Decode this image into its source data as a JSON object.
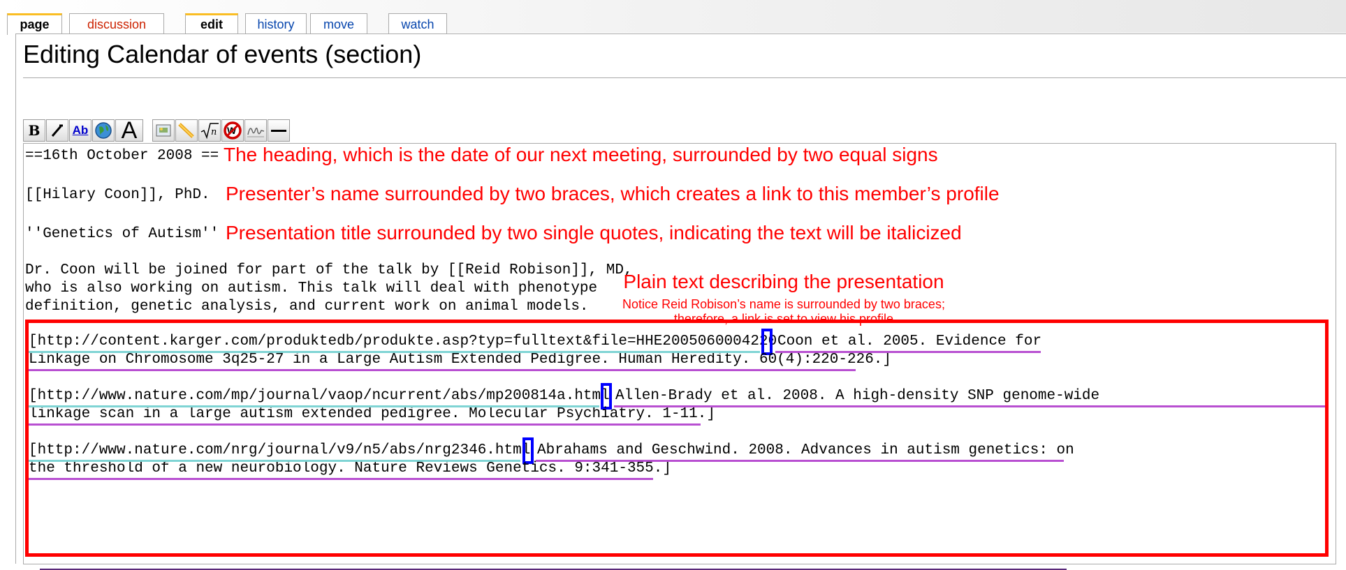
{
  "tabs": [
    {
      "label": "page"
    },
    {
      "label": "discussion"
    },
    {
      "label": "edit"
    },
    {
      "label": "history"
    },
    {
      "label": "move"
    },
    {
      "label": "watch"
    }
  ],
  "page_title": "Editing Calendar of events (section)",
  "toolbar": {
    "bold_label": "B",
    "italic_label": "I",
    "link_label": "Ab",
    "headline_label": "A"
  },
  "editor": {
    "line_heading": "==16th October 2008 ==",
    "line_presenter": "[[Hilary Coon]], PhD.",
    "line_title": "''Genetics of Autism''",
    "desc_1": "Dr. Coon will be joined for part of the talk by [[Reid Robison]], MD,",
    "desc_2": "who is also working on autism. This talk will deal with phenotype",
    "desc_3": "definition, genetic analysis, and current work on animal models.",
    "ref1_url": "[http://content.karger.com/produktedb/produkte.asp?typ=fulltext&file=HHE2005060004220",
    "ref1_text_a": "Coon et al. 2005. Evidence for",
    "ref1_text_b": "Linkage on Chromosome 3q25-27 in a Large Autism Extended Pedigree. Human Heredity. 60(4):220-226.]",
    "ref2_url": "[http://www.nature.com/mp/journal/vaop/ncurrent/abs/mp200814a.html",
    "ref2_text_a": "Allen-Brady et al. 2008. A high-density SNP genome-wide",
    "ref2_text_b": "linkage scan in a large autism extended pedigree. Molecular Psychiatry. 1-11.]",
    "ref3_url": "[http://www.nature.com/nrg/journal/v9/n5/abs/nrg2346.html",
    "ref3_text_a": "Abrahams and Geschwind. 2008. Advances in autism genetics: on",
    "ref3_text_b": "the threshold of a new neurobiology. Nature Reviews Genetics. 9:341-355.]"
  },
  "annotations": {
    "heading": "The heading, which is the date of our next meeting, surrounded by two equal signs",
    "presenter": "Presenter’s name surrounded by two braces, which creates a link to this member’s profile",
    "title": "Presentation title surrounded by two single quotes, indicating the text will be italicized",
    "plain_text": "Plain text describing the presentation",
    "notice_1": "Notice Reid Robison’s name is surrounded by two braces;",
    "notice_2": "therefore, a link is set to view his profile"
  },
  "colors": {
    "annotation": "#ff0000",
    "marker": "#0000ff",
    "url_underline": "#7fd4d4",
    "text_underline": "#b84fd1",
    "tab_link": "#0645ad",
    "tab_red": "#cc2200",
    "tab_selected_top": "#fabd23"
  }
}
